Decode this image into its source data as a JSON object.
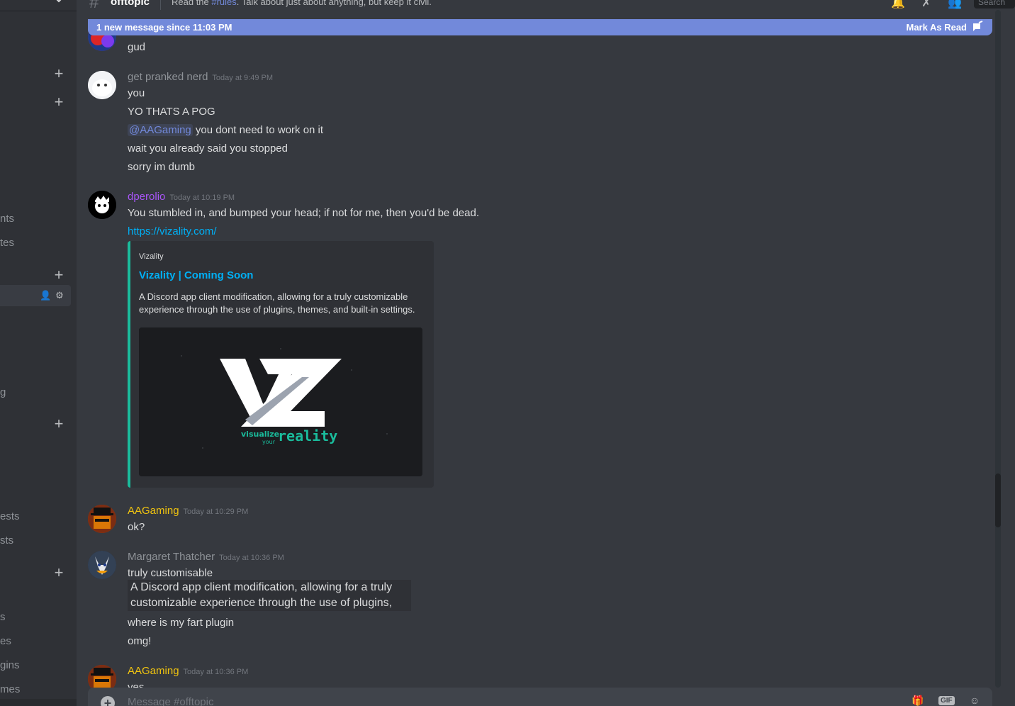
{
  "header": {
    "channel_name": "offtopic",
    "topic_prefix": "Read the ",
    "topic_mention": "#rules",
    "topic_suffix": ". Talk about just about anything, but keep it civil.",
    "search_placeholder": "Search"
  },
  "new_message_bar": {
    "text": "1 new message since 11:03 PM",
    "action": "Mark As Read"
  },
  "sidebar": {
    "partial_labels": [
      "nts",
      "tes",
      "g",
      "ests",
      "sts",
      "s",
      "es",
      "gins",
      "mes"
    ]
  },
  "messages": [
    {
      "lines": [
        "gud"
      ]
    },
    {
      "author": "get pranked nerd",
      "author_color": "#8e9297",
      "timestamp": "Today at 9:49 PM",
      "lines": [
        "you",
        "YO THATS A POG"
      ],
      "mention": "@AAGaming",
      "mention_rest": " you dont need to work on it",
      "more_lines": [
        "wait you already said you stopped",
        "sorry im dumb"
      ]
    },
    {
      "author": "dperolio",
      "author_color": "#a855f7",
      "timestamp": "Today at 10:19 PM",
      "lines": [
        "You stumbled in, and bumped your head; if not for me, then you'd be dead."
      ],
      "link": "https://vizality.com/",
      "embed": {
        "provider": "Vizality",
        "title": "Vizality | Coming Soon",
        "description": "A Discord app client modification, allowing for a truly customizable experience through the use of plugins, themes, and built-in settings.",
        "image_logo": "VZ",
        "image_tag_small": "visualize",
        "image_tag_your": "your",
        "image_tag_big": "reality"
      }
    },
    {
      "author": "AAGaming",
      "author_color": "#f1c40f",
      "timestamp": "Today at 10:29 PM",
      "lines": [
        "ok?"
      ]
    },
    {
      "author": "Margaret Thatcher",
      "author_color": "#8e9297",
      "timestamp": "Today at 10:36 PM",
      "lines": [
        "truly customisable"
      ],
      "quote": "A Discord app client modification, allowing for a truly customizable experience through the use of plugins,",
      "more_lines": [
        "where is my fart plugin",
        "omg!"
      ]
    },
    {
      "author": "AAGaming",
      "author_color": "#f1c40f",
      "timestamp": "Today at 10:36 PM",
      "lines": [
        "yes"
      ]
    }
  ],
  "composer": {
    "placeholder": "Message #offtopic",
    "gif_label": "GIF"
  }
}
